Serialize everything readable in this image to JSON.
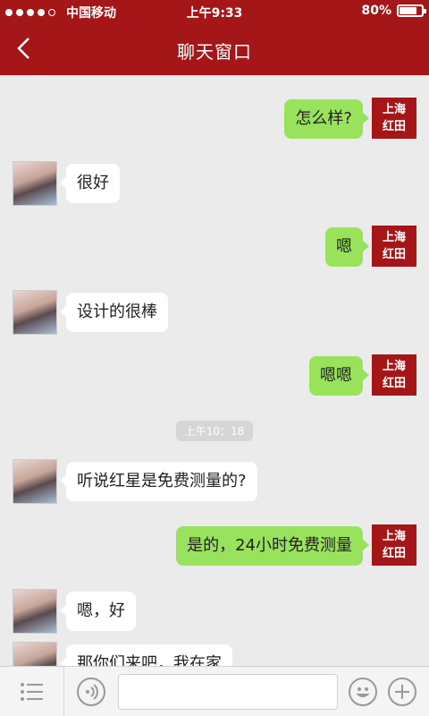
{
  "status_bar": {
    "carrier": "中国移动",
    "time": "上午9:33",
    "battery": "80%",
    "battery_level": 0.8,
    "signal_bars": 4
  },
  "nav": {
    "title": "聊天窗口",
    "back_icon": "chevron-left-icon"
  },
  "brand_avatar": {
    "line1": "上海",
    "line2": "红田"
  },
  "messages": [
    {
      "side": "right",
      "text": "怎么样?"
    },
    {
      "side": "left",
      "text": "很好"
    },
    {
      "side": "right",
      "text": "嗯"
    },
    {
      "side": "left",
      "text": "设计的很棒"
    },
    {
      "side": "right",
      "text": "嗯嗯"
    },
    {
      "side": "left",
      "text": "听说红星是免费测量的?"
    },
    {
      "side": "right",
      "text": "是的，24小时免费测量"
    },
    {
      "side": "left",
      "text": "嗯，好"
    },
    {
      "side": "left",
      "text": "那你们来吧，我在家"
    }
  ],
  "timestamp": "上午10：18",
  "input_bar": {
    "icons": [
      "menu-list-icon",
      "voice-icon",
      "emoji-icon",
      "plus-icon"
    ]
  }
}
